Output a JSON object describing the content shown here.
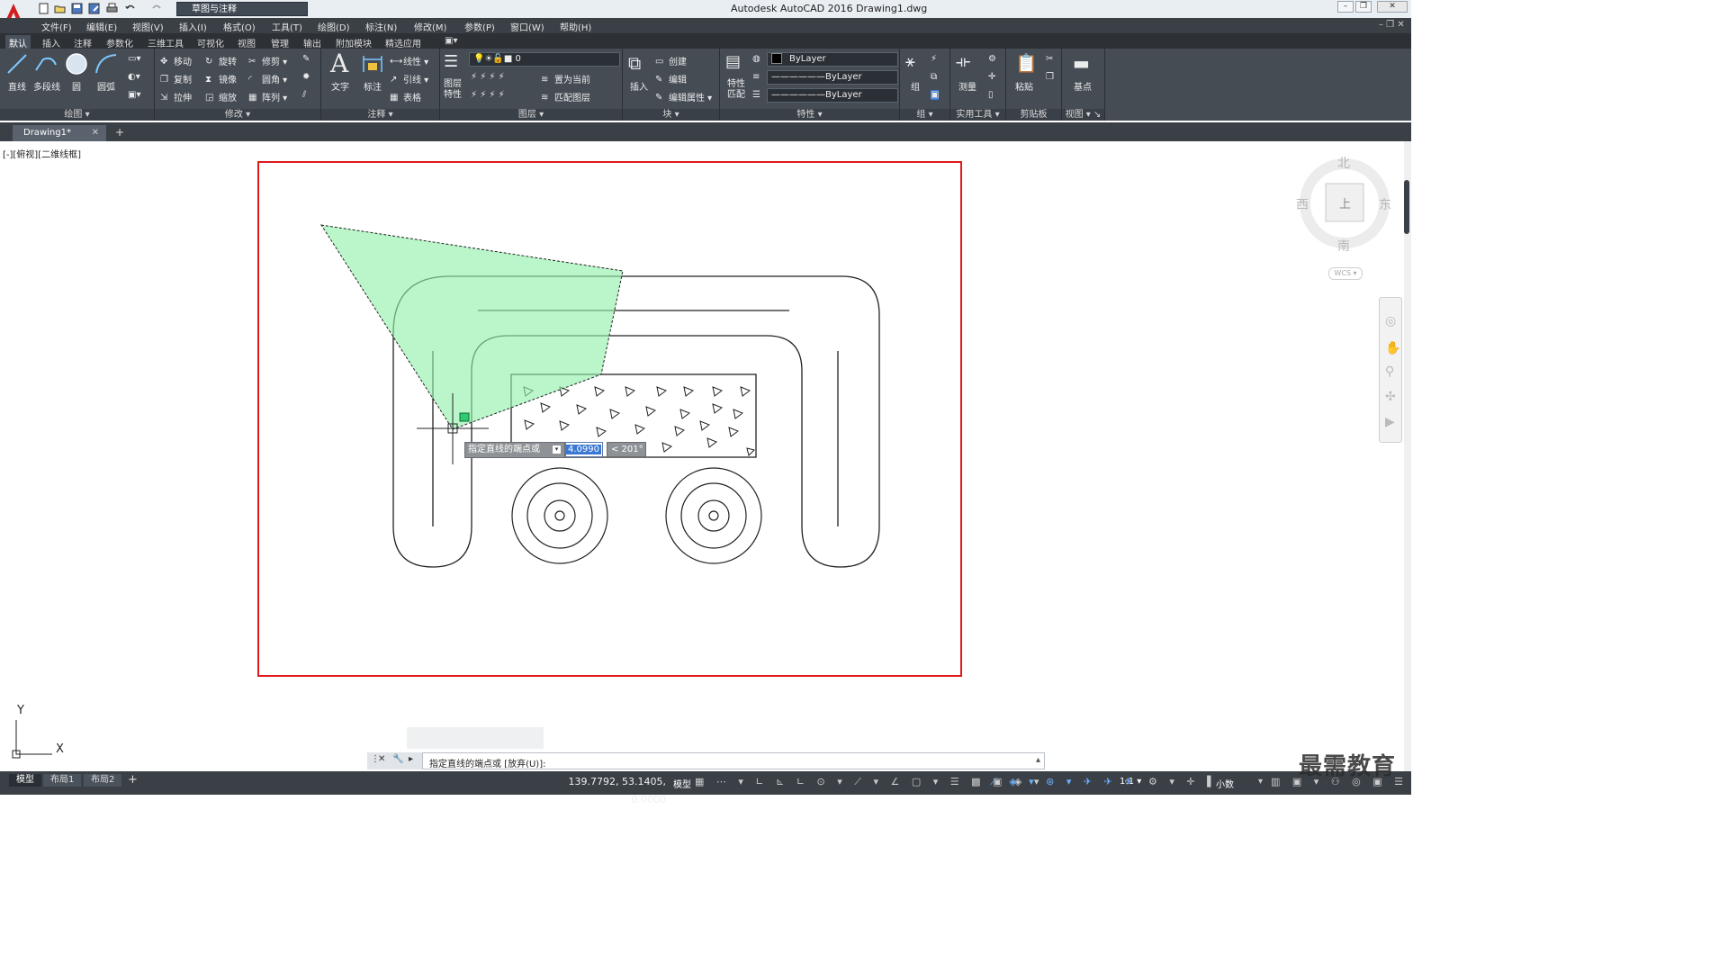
{
  "window": {
    "title": "Autodesk AutoCAD 2016    Drawing1.dwg",
    "workspace": "草图与注释"
  },
  "menu": [
    "文件(F)",
    "编辑(E)",
    "视图(V)",
    "插入(I)",
    "格式(O)",
    "工具(T)",
    "绘图(D)",
    "标注(N)",
    "修改(M)",
    "参数(P)",
    "窗口(W)",
    "帮助(H)"
  ],
  "ribbon_tabs": [
    "默认",
    "插入",
    "注释",
    "参数化",
    "三维工具",
    "可视化",
    "视图",
    "管理",
    "输出",
    "附加模块",
    "精选应用"
  ],
  "panels": {
    "draw": {
      "label": "绘图",
      "line": "直线",
      "polyline": "多段线",
      "circle": "圆",
      "arc": "圆弧"
    },
    "modify": {
      "label": "修改",
      "move": "移动",
      "rotate": "旋转",
      "trim": "修剪",
      "copy": "复制",
      "mirror": "镜像",
      "fillet": "圆角",
      "stretch": "拉伸",
      "scale": "缩放",
      "array": "阵列"
    },
    "annotation": {
      "label": "注释",
      "text": "文字",
      "dimension": "标注",
      "linear": "线性",
      "leader": "引线",
      "table": "表格"
    },
    "layers": {
      "label": "图层",
      "properties": "图层特性",
      "current_layer": "0",
      "set_current": "置为当前",
      "match_layer": "匹配图层"
    },
    "block": {
      "label": "块",
      "insert": "插入",
      "create": "创建",
      "edit": "编辑",
      "edit_attributes": "编辑属性"
    },
    "properties": {
      "label": "特性",
      "match": "特性匹配",
      "color": "ByLayer",
      "linetype": "ByLayer",
      "lineweight": "ByLayer"
    },
    "groups": {
      "label": "组",
      "group": "组"
    },
    "utilities": {
      "label": "实用工具",
      "measure": "测量"
    },
    "clipboard": {
      "label": "剪贴板",
      "paste": "粘贴"
    },
    "view": {
      "label": "视图",
      "base": "基点"
    }
  },
  "file_tab": "Drawing1*",
  "view_label": "[-][俯视][二维线框]",
  "viewcube": {
    "north": "北",
    "south": "南",
    "east": "东",
    "west": "西",
    "top": "上",
    "wcs": "WCS"
  },
  "ucs": {
    "x": "X",
    "y": "Y"
  },
  "dynamic_input": {
    "prompt": "指定直线的端点或",
    "length": "4.0990",
    "angle": "< 201°"
  },
  "command_line": "指定直线的端点或 [放弃(U)]:",
  "layout_tabs": [
    "模型",
    "布局1",
    "布局2"
  ],
  "status": {
    "coordinates": "139.7792, 53.1405, 0.0000",
    "space": "模型",
    "scale": "1:1",
    "units": "小数"
  },
  "watermark": "最需教育",
  "colors": {
    "frame": "#e0191b",
    "fill": "#8ff0a8",
    "ribbon": "#454c54"
  }
}
